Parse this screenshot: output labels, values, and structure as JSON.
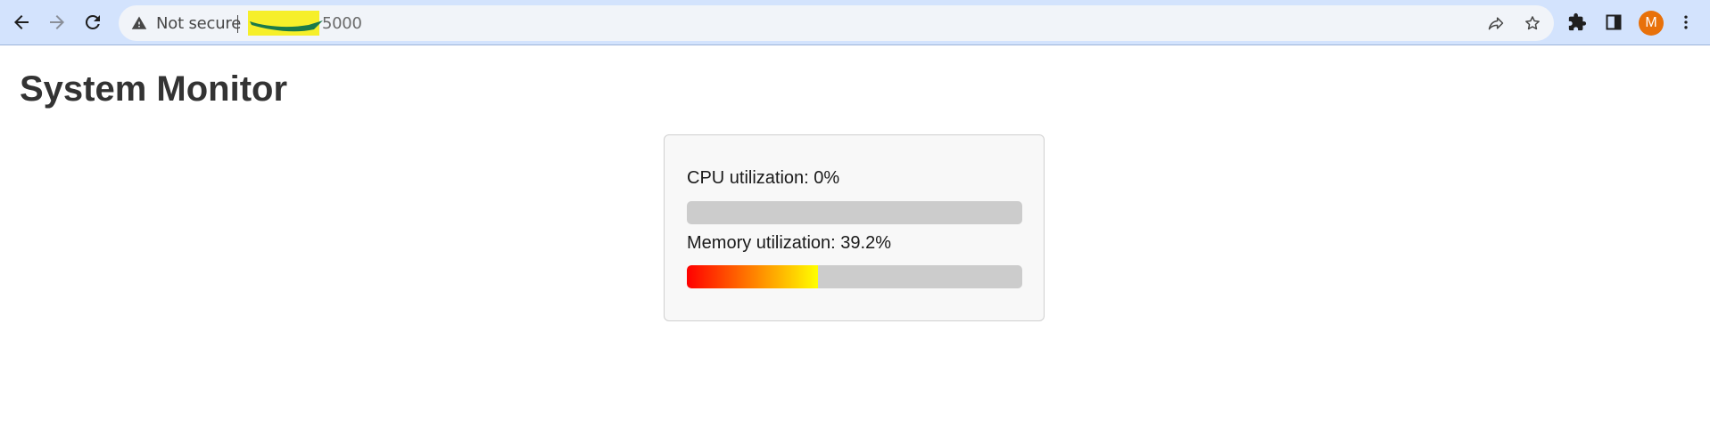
{
  "browser": {
    "security_label": "Not secure",
    "url_visible": "5000",
    "avatar_initial": "M",
    "colors": {
      "toolbar_bg": "#d3e3fd",
      "omnibox_bg": "#f1f4f9",
      "avatar_bg": "#e8710a",
      "redaction_highlight": "#f6ef2a",
      "redaction_scribble": "#1a7a4a"
    },
    "icons": [
      "back-icon",
      "forward-icon",
      "reload-icon",
      "warning-icon",
      "share-icon",
      "star-icon",
      "extensions-icon",
      "side-panel-icon",
      "menu-icon"
    ]
  },
  "page": {
    "title": "System Monitor"
  },
  "metrics": {
    "cpu": {
      "label": "CPU utilization: 0%",
      "percent": 0
    },
    "memory": {
      "label": "Memory utilization: 39.2%",
      "percent": 39.2
    },
    "colors": {
      "track": "#cccccc",
      "gradient_start": "#ff0000",
      "gradient_end": "#ffff00"
    }
  }
}
